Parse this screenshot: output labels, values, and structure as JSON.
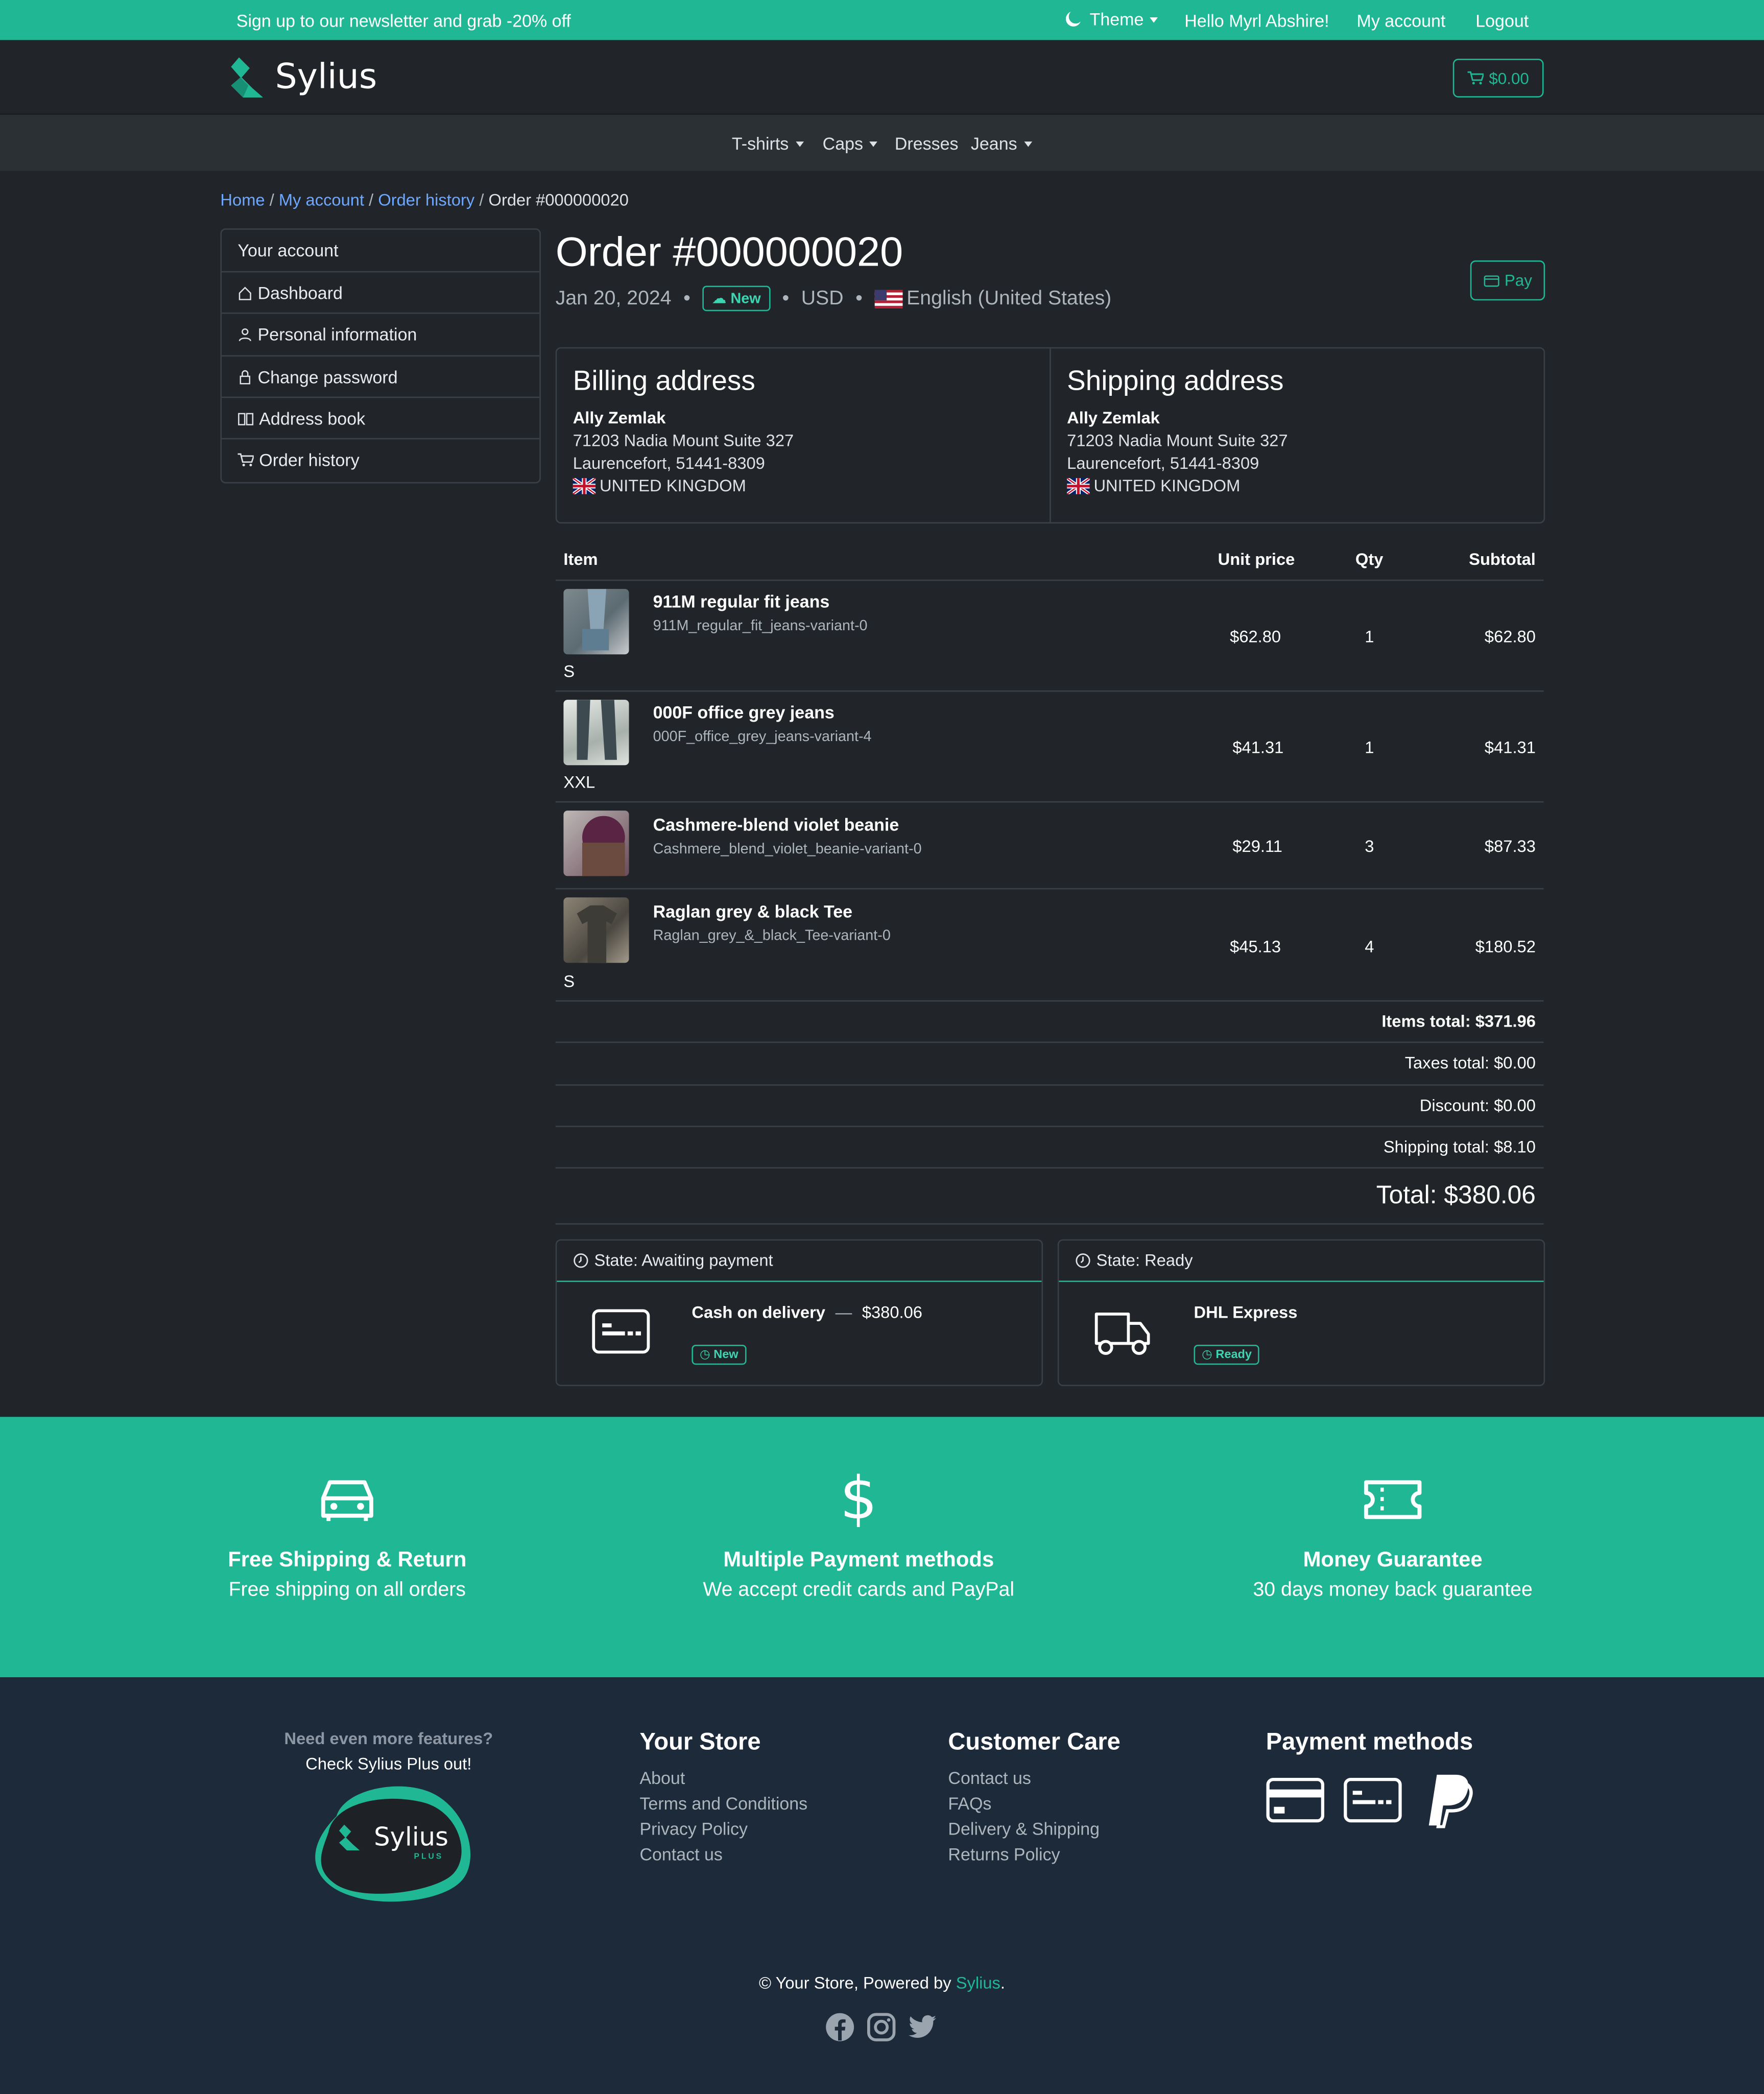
{
  "topbar": {
    "newsletter": "Sign up to our newsletter and grab -20% off",
    "theme": "Theme",
    "greeting": "Hello Myrl Abshire!",
    "my_account": "My account",
    "logout": "Logout"
  },
  "header": {
    "brand": "Sylius",
    "cart": "$0.00"
  },
  "nav": {
    "items": [
      "T-shirts",
      "Caps",
      "Dresses",
      "Jeans"
    ]
  },
  "breadcrumb": {
    "home": "Home",
    "account": "My account",
    "history": "Order history",
    "current": "Order #000000020"
  },
  "sidebar": {
    "title": "Your account",
    "items": [
      "Dashboard",
      "Personal information",
      "Change password",
      "Address book",
      "Order history"
    ]
  },
  "order": {
    "title": "Order #000000020",
    "date": "Jan 20, 2024",
    "status": "New",
    "currency": "USD",
    "locale": "English (United States)",
    "pay": "Pay"
  },
  "billing": {
    "title": "Billing address",
    "name": "Ally Zemlak",
    "street": "71203 Nadia Mount Suite 327",
    "city": "Laurencefort, 51441-8309",
    "country": "UNITED KINGDOM"
  },
  "shipping": {
    "title": "Shipping address",
    "name": "Ally Zemlak",
    "street": "71203 Nadia Mount Suite 327",
    "city": "Laurencefort, 51441-8309",
    "country": "UNITED KINGDOM"
  },
  "table": {
    "headers": {
      "item": "Item",
      "unit_price": "Unit price",
      "qty": "Qty",
      "subtotal": "Subtotal"
    },
    "rows": [
      {
        "name": "911M regular fit jeans",
        "code": "911M_regular_fit_jeans-variant-0",
        "option": "S",
        "unit_price": "$62.80",
        "qty": "1",
        "subtotal": "$62.80"
      },
      {
        "name": "000F office grey jeans",
        "code": "000F_office_grey_jeans-variant-4",
        "option": "XXL",
        "unit_price": "$41.31",
        "qty": "1",
        "subtotal": "$41.31"
      },
      {
        "name": "Cashmere-blend violet beanie",
        "code": "Cashmere_blend_violet_beanie-variant-0",
        "option": "",
        "unit_price": "$29.11",
        "qty": "3",
        "subtotal": "$87.33"
      },
      {
        "name": "Raglan grey & black Tee",
        "code": "Raglan_grey_&_black_Tee-variant-0",
        "option": "S",
        "unit_price": "$45.13",
        "qty": "4",
        "subtotal": "$180.52"
      }
    ]
  },
  "totals": {
    "items": "Items total: $371.96",
    "taxes": "Taxes total: $0.00",
    "discount": "Discount: $0.00",
    "shipping": "Shipping total: $8.10",
    "total": "Total: $380.06"
  },
  "payment": {
    "state": "State: Awaiting payment",
    "method": "Cash on delivery",
    "dash": "—",
    "amount": "$380.06",
    "badge": "New"
  },
  "shipment": {
    "state": "State: Ready",
    "method": "DHL Express",
    "badge": "Ready"
  },
  "features": [
    {
      "title": "Free Shipping & Return",
      "subtitle": "Free shipping on all orders"
    },
    {
      "title": "Multiple Payment methods",
      "subtitle": "We accept credit cards and PayPal"
    },
    {
      "title": "Money Guarantee",
      "subtitle": "30 days money back guarantee"
    }
  ],
  "footer": {
    "plus_question": "Need even more features?",
    "plus_cta": "Check Sylius Plus out!",
    "plus_logo": "Sylius",
    "plus_sub": "PLUS",
    "store_title": "Your Store",
    "store_links": [
      "About",
      "Terms and Conditions",
      "Privacy Policy",
      "Contact us"
    ],
    "care_title": "Customer Care",
    "care_links": [
      "Contact us",
      "FAQs",
      "Delivery & Shipping",
      "Returns Policy"
    ],
    "payment_title": "Payment methods",
    "copyright": "© Your Store, Powered by",
    "powered": "Sylius",
    "period": "."
  }
}
